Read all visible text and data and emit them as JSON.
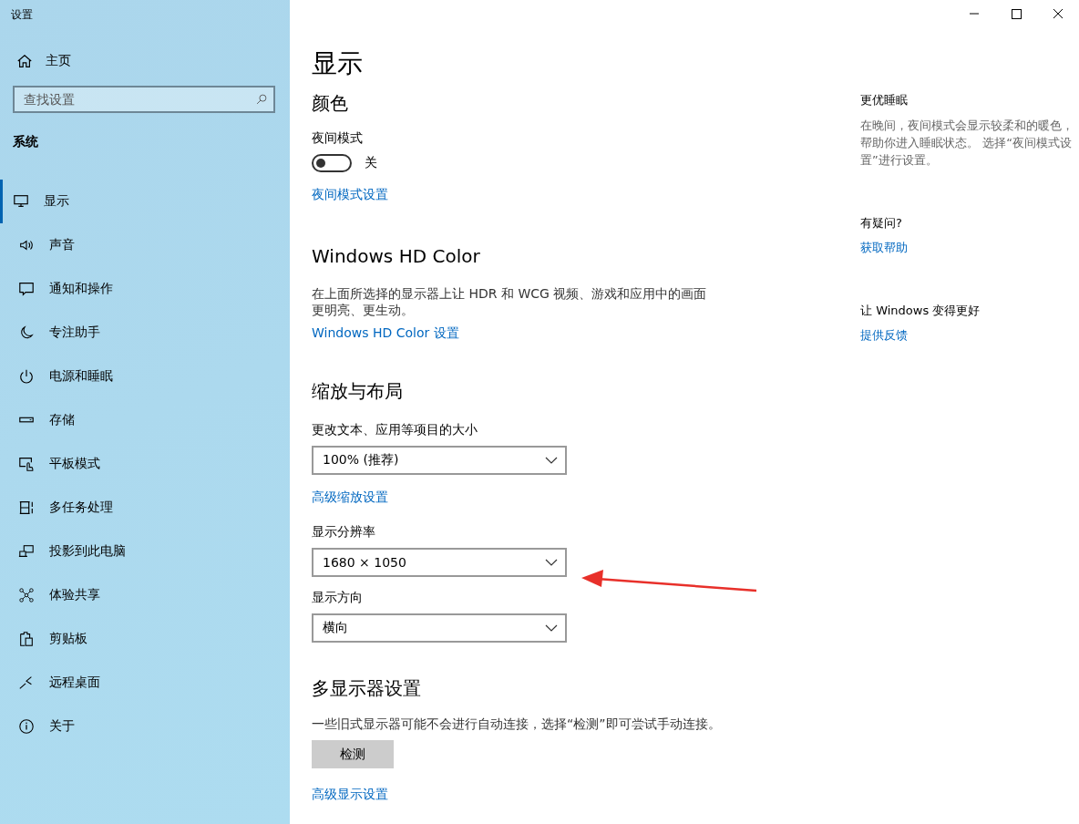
{
  "window": {
    "title": "设置"
  },
  "sidebar": {
    "home": "主页",
    "search": {
      "placeholder": "查找设置"
    },
    "section": "系统",
    "items": [
      {
        "label": "显示",
        "selected": true
      },
      {
        "label": "声音",
        "selected": false
      },
      {
        "label": "通知和操作",
        "selected": false
      },
      {
        "label": "专注助手",
        "selected": false
      },
      {
        "label": "电源和睡眠",
        "selected": false
      },
      {
        "label": "存储",
        "selected": false
      },
      {
        "label": "平板模式",
        "selected": false
      },
      {
        "label": "多任务处理",
        "selected": false
      },
      {
        "label": "投影到此电脑",
        "selected": false
      },
      {
        "label": "体验共享",
        "selected": false
      },
      {
        "label": "剪贴板",
        "selected": false
      },
      {
        "label": "远程桌面",
        "selected": false
      },
      {
        "label": "关于",
        "selected": false
      }
    ]
  },
  "page": {
    "title": "显示",
    "color": {
      "heading": "颜色",
      "night_mode": {
        "label": "夜间模式",
        "on": false,
        "state_text": "关"
      },
      "link": "夜间模式设置"
    },
    "hd_color": {
      "heading": "Windows HD Color",
      "description": "在上面所选择的显示器上让 HDR 和 WCG 视频、游戏和应用中的画面更明亮、更生动。",
      "link": "Windows HD Color 设置"
    },
    "scale": {
      "heading": "缩放与布局",
      "controls": [
        {
          "kind": "dropdown",
          "label": "更改文本、应用等项目的大小",
          "value": "100% (推荐)"
        },
        {
          "kind": "link",
          "text": "高级缩放设置"
        },
        {
          "kind": "dropdown",
          "label": "显示分辨率",
          "value": "1680 × 1050"
        },
        {
          "kind": "dropdown",
          "label": "显示方向",
          "value": "横向"
        }
      ]
    },
    "multi_display": {
      "heading": "多显示器设置",
      "description": "一些旧式显示器可能不会进行自动连接，选择“检测”即可尝试手动连接。",
      "button": "检测",
      "link": "高级显示设置"
    }
  },
  "aside": [
    {
      "heading": "更优睡眠",
      "text": "在晚间，夜间模式会显示较柔和的暖色，帮助你进入睡眠状态。 选择“夜间模式设置”进行设置。"
    },
    {
      "heading": "有疑问?",
      "link": "获取帮助"
    },
    {
      "heading": "让 Windows 变得更好",
      "link": "提供反馈"
    }
  ]
}
